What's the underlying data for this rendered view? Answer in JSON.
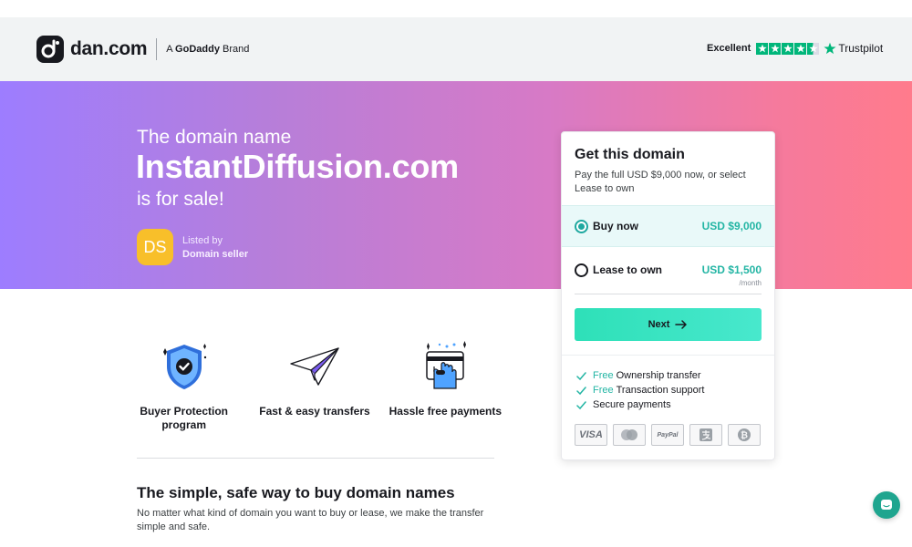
{
  "header": {
    "logo_text": "dan.com",
    "brand_prefix": "A",
    "brand_name": "GoDaddy",
    "brand_suffix": "Brand",
    "trust_label": "Excellent",
    "trust_stars": 4.5,
    "trust_provider": "Trustpilot",
    "trust_color": "#00b67a"
  },
  "hero": {
    "pre": "The domain name",
    "domain": "InstantDiffusion.com",
    "post": "is for sale!",
    "seller_initials": "DS",
    "listed_by": "Listed by",
    "seller_name": "Domain seller",
    "gradient": [
      "#9d7dff",
      "#ff7b8c"
    ]
  },
  "features": [
    {
      "label": "Buyer Protection program",
      "icon": "shield-check-icon"
    },
    {
      "label": "Fast & easy transfers",
      "icon": "paper-plane-icon"
    },
    {
      "label": "Hassle free payments",
      "icon": "payment-card-hand-icon"
    }
  ],
  "info": {
    "title": "The simple, safe way to buy domain names",
    "text": "No matter what kind of domain you want to buy or lease, we make the transfer simple and safe."
  },
  "card": {
    "title": "Get this domain",
    "subtitle": "Pay the full USD $9,000 now, or select Lease to own",
    "options": [
      {
        "label": "Buy now",
        "price": "USD $9,000",
        "selected": true
      },
      {
        "label": "Lease to own",
        "price": "USD $1,500",
        "period": "/month",
        "selected": false
      }
    ],
    "next_label": "Next",
    "benefits": [
      {
        "free": "Free",
        "text": "Ownership transfer"
      },
      {
        "free": "Free",
        "text": "Transaction support"
      },
      {
        "free": "",
        "text": "Secure payments"
      }
    ],
    "payment_methods": [
      "VISA",
      "mastercard",
      "PayPal",
      "alipay",
      "bitcoin"
    ],
    "accent": "#23b5a4"
  }
}
